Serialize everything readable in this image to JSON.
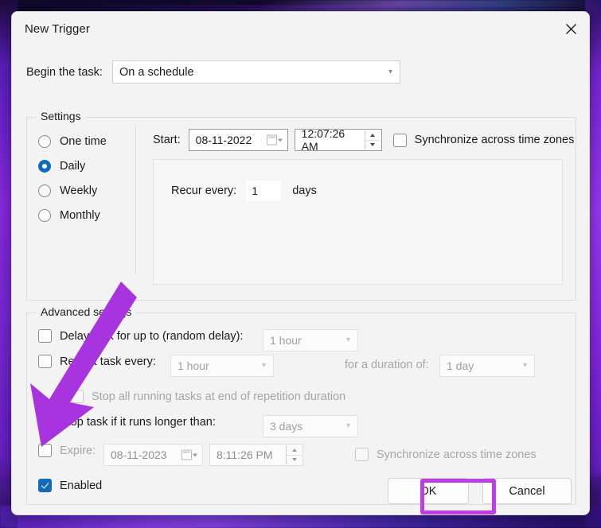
{
  "window": {
    "title": "New Trigger",
    "close_icon": "close-icon"
  },
  "begin": {
    "label": "Begin the task:",
    "value": "On a schedule",
    "chevron": "⌄"
  },
  "settings": {
    "legend": "Settings",
    "schedule_options": [
      {
        "label": "One time",
        "selected": false
      },
      {
        "label": "Daily",
        "selected": true
      },
      {
        "label": "Weekly",
        "selected": false
      },
      {
        "label": "Monthly",
        "selected": false
      }
    ],
    "start_label": "Start:",
    "start_date": "08-11-2022",
    "start_time": "12:07:26 AM",
    "sync_label": "Synchronize across time zones",
    "sync_checked": false,
    "recur_label": "Recur every:",
    "recur_value": "1",
    "recur_unit": "days"
  },
  "advanced": {
    "legend": "Advanced settings",
    "delay_label": "Delay task for up to (random delay):",
    "delay_value": "1 hour",
    "repeat_label": "Repeat task every:",
    "repeat_value": "1 hour",
    "duration_label": "for a duration of:",
    "duration_value": "1 day",
    "stop_all_label": "Stop all running tasks at end of repetition duration",
    "stop_longer_label": "Stop task if it runs longer than:",
    "stop_longer_value": "3 days",
    "expire_label": "Expire:",
    "expire_date": "08-11-2023",
    "expire_time": "8:11:26 PM",
    "expire_sync_label": "Synchronize across time zones",
    "enabled_label": "Enabled",
    "enabled_checked": true
  },
  "footer": {
    "ok_label": "OK",
    "cancel_label": "Cancel"
  },
  "annotations": {
    "highlight_color": "#c13ce6",
    "arrow_color": "#a834e0",
    "arrow_target": "enabled-checkbox",
    "highlight_target": "ok-button"
  },
  "colors": {
    "accent": "#0f6cbd",
    "dialog_bg": "#f3f3f3",
    "text": "#1b1b1b",
    "disabled_text": "#a6a6a6"
  }
}
